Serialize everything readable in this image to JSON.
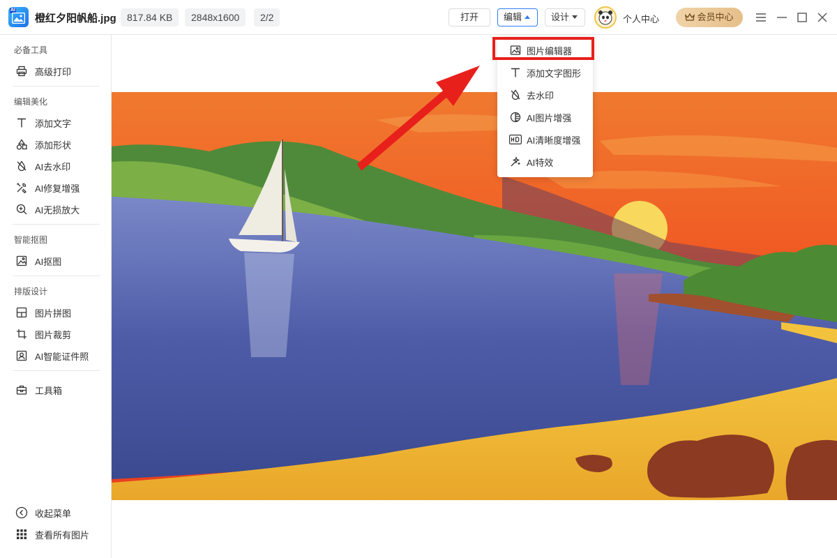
{
  "titlebar": {
    "file_name": "橙红夕阳帆船.jpg",
    "file_size": "817.84 KB",
    "dimensions": "2848x1600",
    "page_counter": "2/2",
    "open_label": "打开",
    "edit_label": "编辑",
    "design_label": "设计",
    "user_center": "个人中心",
    "vip_center": "会员中心"
  },
  "sidebar": {
    "sections": [
      {
        "title": "必备工具",
        "items": [
          {
            "label": "高级打印",
            "icon": "printer-icon"
          }
        ]
      },
      {
        "title": "编辑美化",
        "items": [
          {
            "label": "添加文字",
            "icon": "text-icon"
          },
          {
            "label": "添加形状",
            "icon": "shapes-icon"
          },
          {
            "label": "AI去水印",
            "icon": "watermark-off-icon"
          },
          {
            "label": "AI修复增强",
            "icon": "repair-tools-icon"
          },
          {
            "label": "AI无损放大",
            "icon": "zoom-in-icon"
          }
        ]
      },
      {
        "title": "智能抠图",
        "items": [
          {
            "label": "AI抠图",
            "icon": "cutout-icon"
          }
        ]
      },
      {
        "title": "排版设计",
        "items": [
          {
            "label": "图片拼图",
            "icon": "collage-icon"
          },
          {
            "label": "图片裁剪",
            "icon": "crop-icon"
          },
          {
            "label": "AI智能证件照",
            "icon": "id-photo-icon"
          }
        ]
      }
    ],
    "toolbox": "工具箱",
    "collapse_menu": "收起菜单",
    "view_all": "查看所有图片"
  },
  "edit_menu": {
    "items": [
      {
        "label": "图片编辑器",
        "icon": "image-editor-icon",
        "highlighted": true
      },
      {
        "label": "添加文字图形",
        "icon": "text-icon"
      },
      {
        "label": "去水印",
        "icon": "watermark-off-icon"
      },
      {
        "label": "AI图片增强",
        "icon": "enhance-icon"
      },
      {
        "label": "AI清晰度增强",
        "icon": "hd-icon"
      },
      {
        "label": "AI特效",
        "icon": "magic-wand-icon"
      }
    ]
  },
  "colors": {
    "accent": "#2f7cf6",
    "highlight": "#e8201b",
    "vip_gradient_start": "#f0d3a8"
  }
}
